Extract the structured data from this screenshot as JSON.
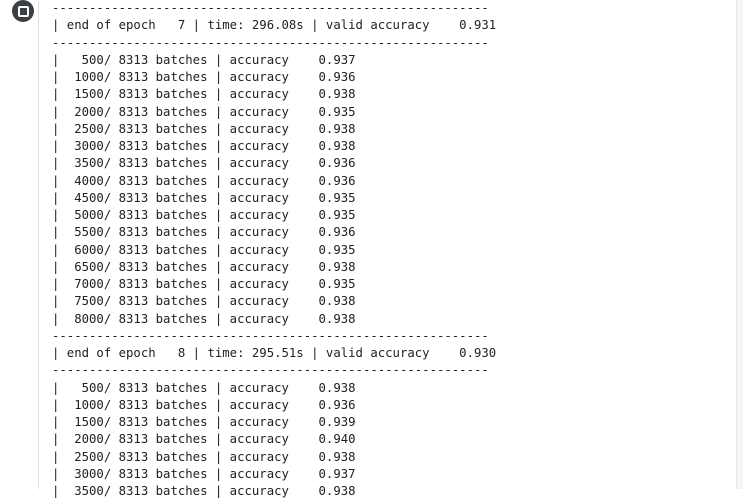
{
  "output": {
    "lines": [
      "-----------------------------------------------------------",
      "| end of epoch   7 | time: 296.08s | valid accuracy    0.931",
      "-----------------------------------------------------------",
      "|   500/ 8313 batches | accuracy    0.937",
      "|  1000/ 8313 batches | accuracy    0.936",
      "|  1500/ 8313 batches | accuracy    0.938",
      "|  2000/ 8313 batches | accuracy    0.935",
      "|  2500/ 8313 batches | accuracy    0.938",
      "|  3000/ 8313 batches | accuracy    0.938",
      "|  3500/ 8313 batches | accuracy    0.936",
      "|  4000/ 8313 batches | accuracy    0.936",
      "|  4500/ 8313 batches | accuracy    0.935",
      "|  5000/ 8313 batches | accuracy    0.935",
      "|  5500/ 8313 batches | accuracy    0.936",
      "|  6000/ 8313 batches | accuracy    0.935",
      "|  6500/ 8313 batches | accuracy    0.938",
      "|  7000/ 8313 batches | accuracy    0.935",
      "|  7500/ 8313 batches | accuracy    0.938",
      "|  8000/ 8313 batches | accuracy    0.938",
      "-----------------------------------------------------------",
      "| end of epoch   8 | time: 295.51s | valid accuracy    0.930",
      "-----------------------------------------------------------",
      "|   500/ 8313 batches | accuracy    0.938",
      "|  1000/ 8313 batches | accuracy    0.936",
      "|  1500/ 8313 batches | accuracy    0.939",
      "|  2000/ 8313 batches | accuracy    0.940",
      "|  2500/ 8313 batches | accuracy    0.938",
      "|  3000/ 8313 batches | accuracy    0.937",
      "|  3500/ 8313 batches | accuracy    0.938"
    ]
  },
  "icons": {
    "run_status": "stop-icon"
  }
}
